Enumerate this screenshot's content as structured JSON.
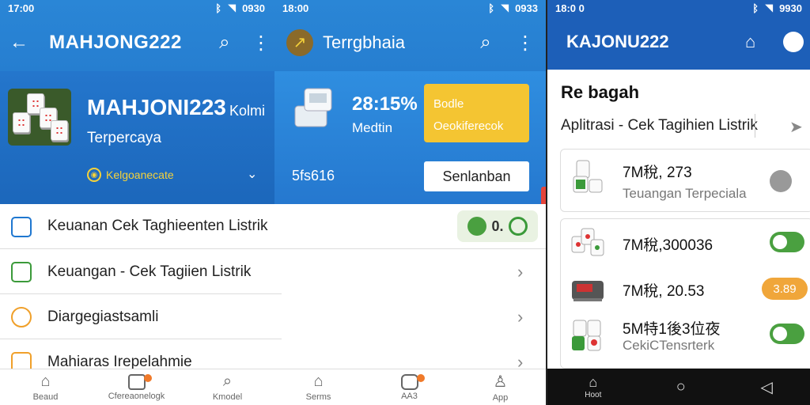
{
  "left": {
    "status_left": "17:00",
    "status_right": "0930",
    "title": "MAHJONG222",
    "hero": {
      "title": "MAHJONI223",
      "kolmi": "Kolmi",
      "subtitle": "Terpercaya",
      "badge": "Kelgoanecate"
    },
    "list": [
      {
        "label": "Keuanan Cek Taghieenten Listrik"
      },
      {
        "label": "Keuangan - Cek Tagiien Listrik"
      },
      {
        "label": "Diargegiastsamli"
      },
      {
        "label": "Mahiaras Irepelahmie"
      }
    ],
    "pill_text": "0.",
    "nav": [
      {
        "label": "Beaud"
      },
      {
        "label": "Cfereaonelogk"
      },
      {
        "label": "Kmodel"
      }
    ]
  },
  "middle": {
    "status_left": "18:00",
    "status_right": "0933",
    "title": "Terrgbhaia",
    "device": {
      "value": "28:15%",
      "label": "Medtin",
      "small": "5fs616"
    },
    "yellow_box": [
      "Bodle",
      "Oeokiferecok"
    ],
    "button_label": "Senlanban",
    "nav": [
      {
        "label": "Serms"
      },
      {
        "label": "AA3"
      },
      {
        "label": "App"
      }
    ]
  },
  "right": {
    "status_left": "18:0 0",
    "status_right": "9930",
    "title": "KAJONU222",
    "heading": "Re bagah",
    "subtitle": "Aplitrasi - Cek Tagihien Listrik",
    "items": [
      {
        "name": "7M稅, 273",
        "sub": "Teuangan Terpeciala",
        "control": "grey"
      },
      {
        "name": "7M稅,300036",
        "sub": "",
        "control": "toggle"
      },
      {
        "name": "7M稅, 20.53",
        "sub": "",
        "control": "orange",
        "badge": "3.89"
      },
      {
        "name": "5M特1後3位夜",
        "sub": "CekiCTensrterk",
        "control": "toggle"
      }
    ],
    "nav": {
      "home": "Hoot"
    }
  },
  "colors": {
    "primary_blue": "#1f6fc5",
    "accent_yellow": "#f4c532",
    "accent_green": "#4aa040",
    "accent_orange": "#f0a63a"
  }
}
